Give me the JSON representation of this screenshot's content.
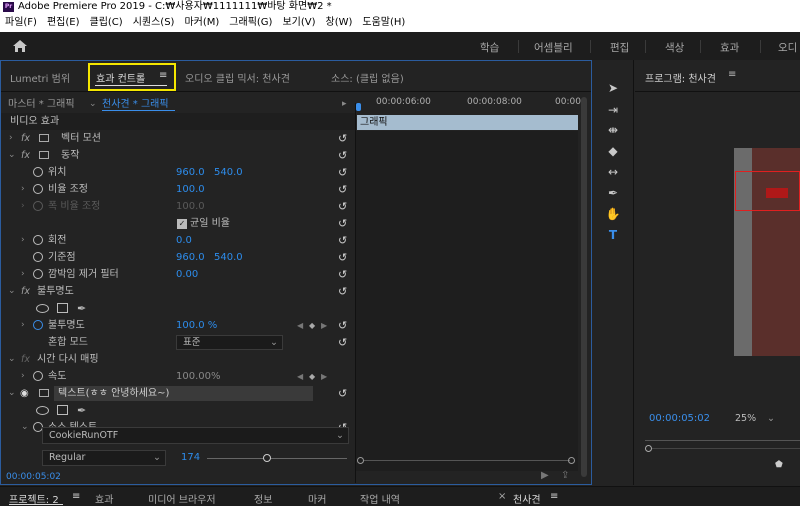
{
  "titlebar": {
    "title": "Adobe Premiere Pro 2019 - C:₩사용자₩1111111₩바탕 화면₩2 *",
    "app_badge": "Pr"
  },
  "menu": [
    "파일(F)",
    "편집(E)",
    "클립(C)",
    "시퀀스(S)",
    "마커(M)",
    "그래픽(G)",
    "보기(V)",
    "창(W)",
    "도움말(H)"
  ],
  "workspaces": [
    "학습",
    "어셈블리",
    "편집",
    "색상",
    "효과",
    "오디"
  ],
  "panel_tabs": {
    "lumetri": "Lumetri 범위",
    "effect_controls": "효과 컨트롤",
    "menu_glyph": "≡",
    "audio_mixer": "오디오 클립 믹서: 천사견",
    "source": "소스: (클립 없음)"
  },
  "sub_header": {
    "master": "마스터 * 그래픽",
    "sequence": "천사견 * 그래픽",
    "time_a": "00:00:06:00",
    "time_b": "00:00:08:00",
    "time_c": "00:00:"
  },
  "section_video": "비디오 효과",
  "clip_name": "그래픽",
  "effects": {
    "vector_motion": "벡터 모션",
    "motion": "동작",
    "position": {
      "label": "위치",
      "x": "960.0",
      "y": "540.0"
    },
    "scale": {
      "label": "비율 조정",
      "value": "100.0"
    },
    "scale_width": {
      "label": "폭 비율 조정",
      "value": "100.0"
    },
    "uniform": "균일 비율",
    "rotation": {
      "label": "회전",
      "value": "0.0"
    },
    "anchor": {
      "label": "기준점",
      "x": "960.0",
      "y": "540.0"
    },
    "flicker": {
      "label": "깜박임 제거 필터",
      "value": "0.00"
    },
    "opacity_group": "불투명도",
    "opacity": {
      "label": "불투명도",
      "value": "100.0 %"
    },
    "blend": {
      "label": "혼합 모드",
      "value": "표준"
    },
    "time_remap": "시간 다시 매핑",
    "speed": {
      "label": "속도",
      "value": "100.00%"
    },
    "text_layer": "텍스트(ㅎㅎ 안녕하세요~)",
    "source_text": "소스 텍스트",
    "font": "CookieRunOTF",
    "font_style": "Regular",
    "font_size": "174"
  },
  "current_time": "00:00:05:02",
  "program": {
    "title": "프로그램: 천사견",
    "timecode": "00:00:05:02",
    "zoom": "25%"
  },
  "bottom_tabs": [
    "프로젝트: 2",
    "효과",
    "미디어 브라우저",
    "정보",
    "마커",
    "작업 내역"
  ],
  "bottom_right": "천사견",
  "colors": {
    "accent": "#2d8ceb",
    "highlight": "#f5e600",
    "clip": "#a5bccf"
  }
}
